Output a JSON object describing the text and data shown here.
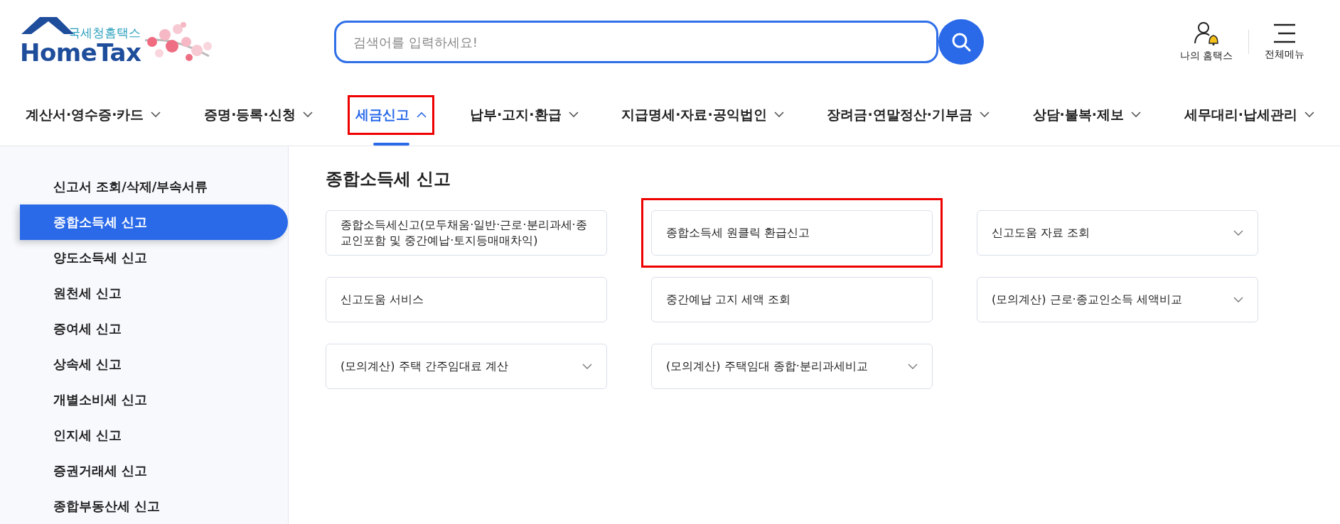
{
  "header": {
    "logo": {
      "subtitle": "국세청홈택스",
      "title": "HomeTax"
    },
    "search": {
      "placeholder": "검색어를 입력하세요!"
    },
    "utilities": [
      {
        "kind": "my",
        "label": "나의 홈택스"
      },
      {
        "kind": "menu",
        "label": "전체메뉴"
      }
    ]
  },
  "nav": [
    {
      "label": "계산서·영수증·카드",
      "selected": false,
      "expanded": false,
      "highlighted": false
    },
    {
      "label": "증명·등록·신청",
      "selected": false,
      "expanded": false,
      "highlighted": false
    },
    {
      "label": "세금신고",
      "selected": true,
      "expanded": true,
      "highlighted": true
    },
    {
      "label": "납부·고지·환급",
      "selected": false,
      "expanded": false,
      "highlighted": false
    },
    {
      "label": "지급명세·자료·공익법인",
      "selected": false,
      "expanded": false,
      "highlighted": false
    },
    {
      "label": "장려금·연말정산·기부금",
      "selected": false,
      "expanded": false,
      "highlighted": false
    },
    {
      "label": "상담·불복·제보",
      "selected": false,
      "expanded": false,
      "highlighted": false
    },
    {
      "label": "세무대리·납세관리",
      "selected": false,
      "expanded": false,
      "highlighted": false
    }
  ],
  "sidebar": {
    "items": [
      {
        "label": "신고서 조회/삭제/부속서류",
        "selected": false
      },
      {
        "label": "종합소득세 신고",
        "selected": true
      },
      {
        "label": "양도소득세 신고",
        "selected": false
      },
      {
        "label": "원천세 신고",
        "selected": false
      },
      {
        "label": "증여세 신고",
        "selected": false
      },
      {
        "label": "상속세 신고",
        "selected": false
      },
      {
        "label": "개별소비세 신고",
        "selected": false
      },
      {
        "label": "인지세 신고",
        "selected": false
      },
      {
        "label": "증권거래세 신고",
        "selected": false
      },
      {
        "label": "종합부동산세 신고",
        "selected": false
      }
    ]
  },
  "content": {
    "title": "종합소득세 신고",
    "cards": [
      {
        "label": "종합소득세신고(모두채움·일반·근로·분리과세·종교인포함 및 중간예납·토지등매매차익)",
        "expandable": false,
        "highlighted": false
      },
      {
        "label": "종합소득세 원클릭 환급신고",
        "expandable": false,
        "highlighted": true
      },
      {
        "label": "신고도움 자료 조회",
        "expandable": true,
        "highlighted": false
      },
      {
        "label": "신고도움 서비스",
        "expandable": false,
        "highlighted": false
      },
      {
        "label": "중간예납 고지 세액 조회",
        "expandable": false,
        "highlighted": false
      },
      {
        "label": "(모의계산) 근로·종교인소득 세액비교",
        "expandable": true,
        "highlighted": false
      },
      {
        "label": "(모의계산) 주택 간주임대료 계산",
        "expandable": true,
        "highlighted": false
      },
      {
        "label": "(모의계산) 주택임대 종합·분리과세비교",
        "expandable": true,
        "highlighted": false
      }
    ]
  }
}
